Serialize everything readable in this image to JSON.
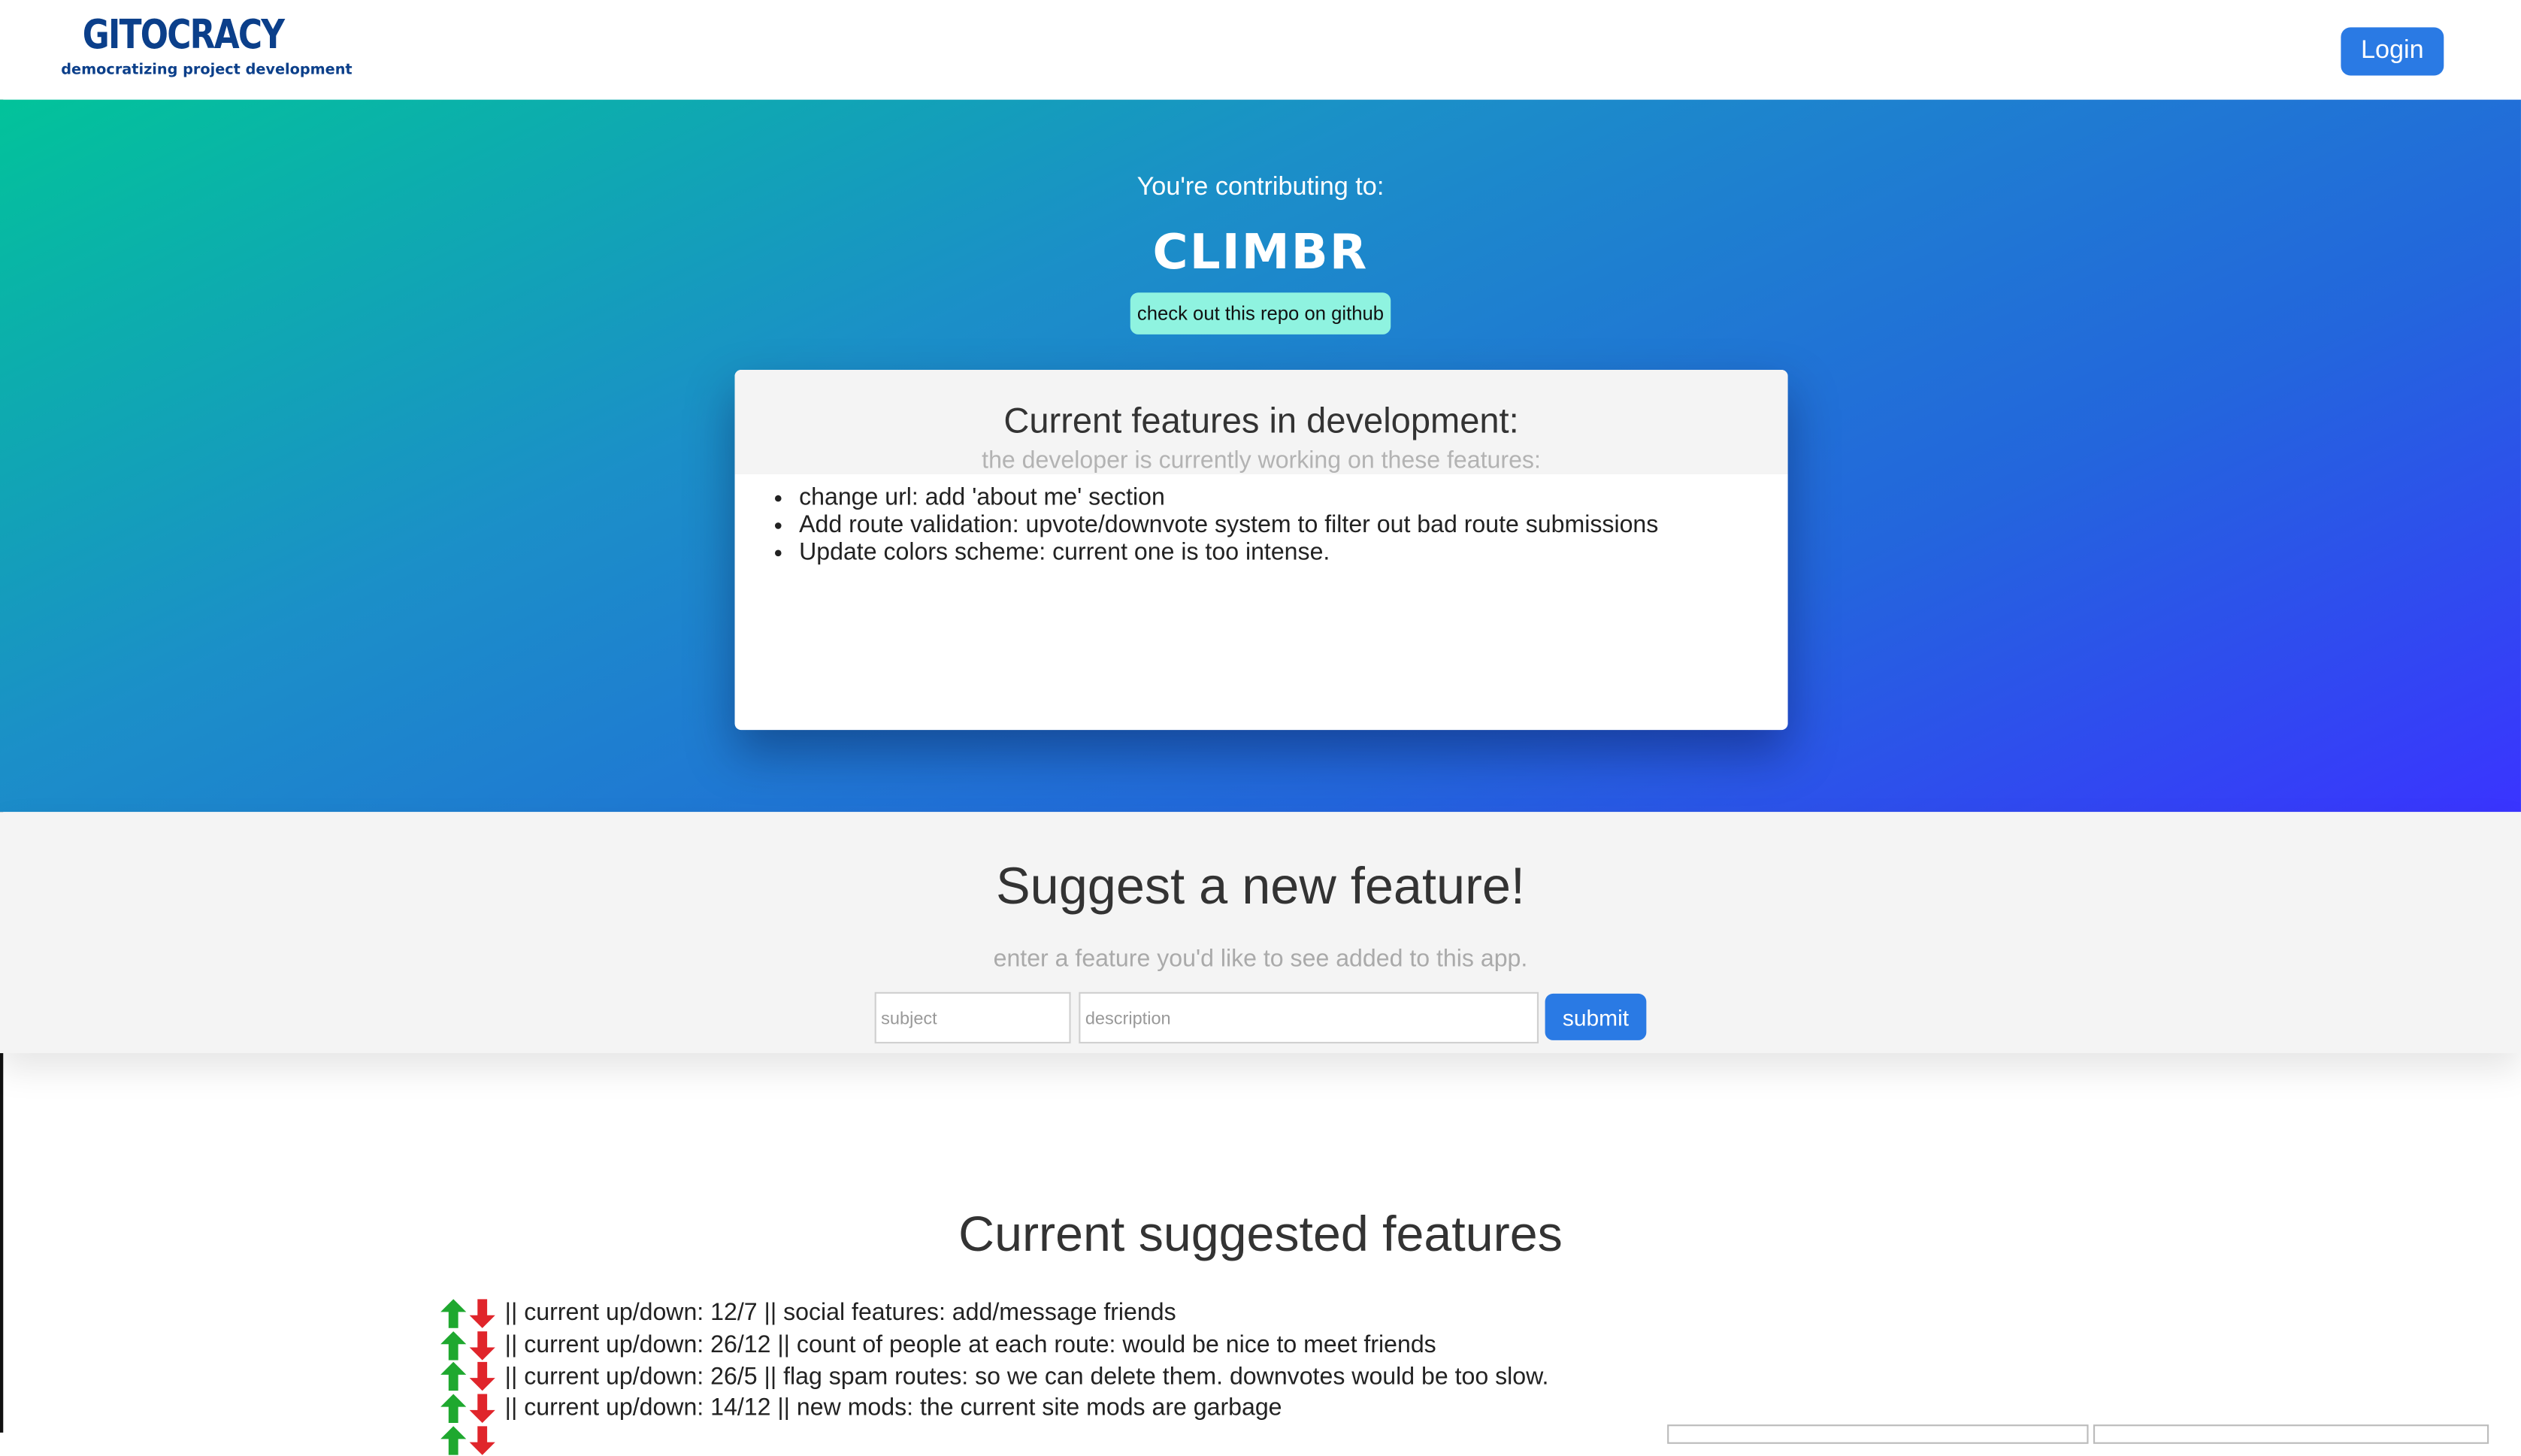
{
  "header": {
    "brand_title": "GITOCRACY",
    "brand_subtitle": "democratizing project development",
    "login_label": "Login"
  },
  "hero": {
    "contributing_label": "You're contributing to:",
    "repo_name": "CLIMBR",
    "github_button_label": "check out this repo on github"
  },
  "dev_card": {
    "title": "Current features in development:",
    "subtitle": "the developer is currently working on these features:",
    "items": [
      "change url: add 'about me' section",
      "Add route validation: upvote/downvote system to filter out bad route submissions",
      "Update colors scheme: current one is too intense."
    ]
  },
  "suggest": {
    "title": "Suggest a new feature!",
    "subtitle": "enter a feature you'd like to see added to this app.",
    "subject_placeholder": "subject",
    "description_placeholder": "description",
    "submit_label": "submit"
  },
  "suggested": {
    "title": "Current suggested features",
    "rows": [
      "|| current up/down: 12/7 || social features: add/message friends",
      "|| current up/down: 26/12 || count of people at each route: would be nice to meet friends",
      "|| current up/down: 26/5 || flag spam routes: so we can delete them. downvotes would be too slow.",
      "|| current up/down: 14/12 || new mods: the current site mods are garbage"
    ]
  },
  "colors": {
    "brand": "#0b3f8a",
    "primary_button": "#2a7ae4",
    "github_button": "#8ff3e0",
    "upvote": "#1fa82f",
    "downvote": "#e0252b",
    "hero_gradient_start": "#02c39a",
    "hero_gradient_end": "#3a34ff"
  }
}
